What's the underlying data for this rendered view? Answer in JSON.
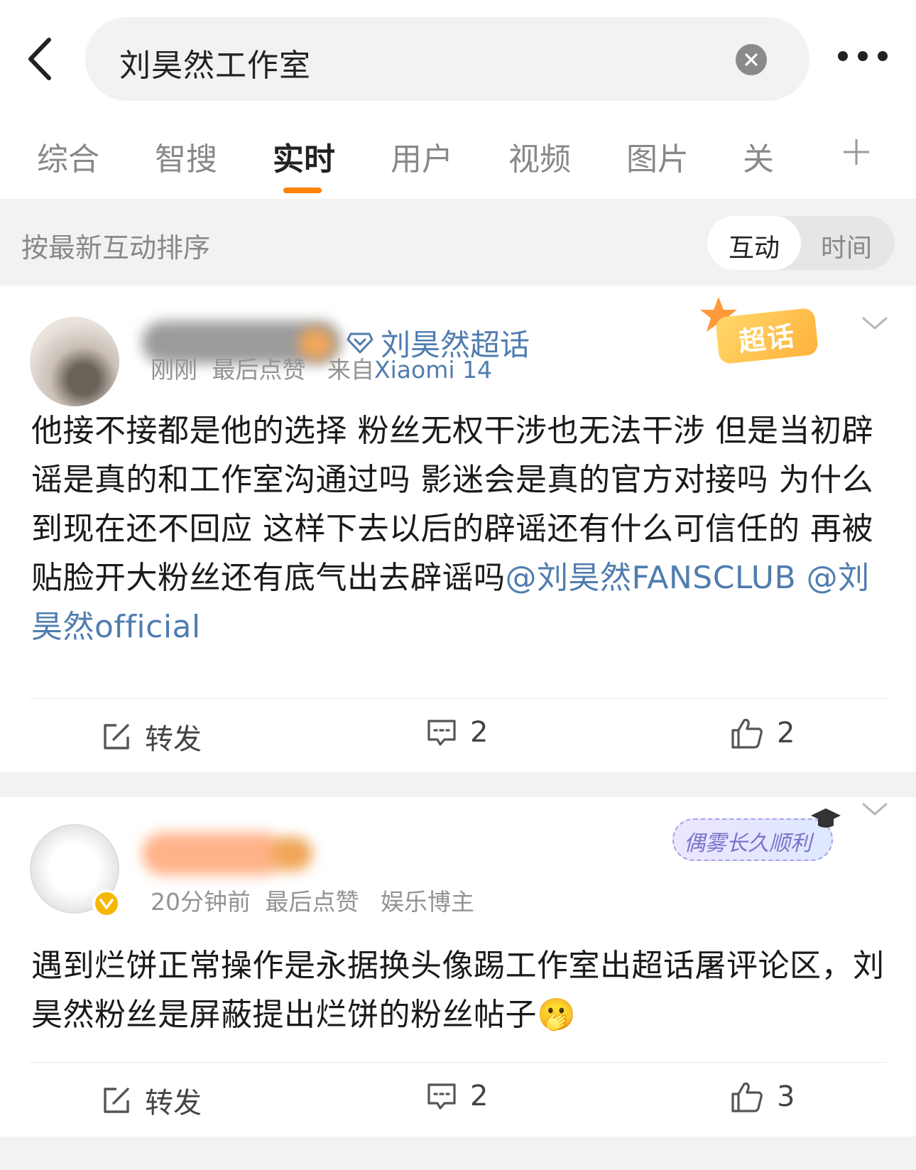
{
  "search": {
    "query": "刘昊然工作室"
  },
  "tabs": [
    {
      "label": "综合"
    },
    {
      "label": "智搜"
    },
    {
      "label": "实时"
    },
    {
      "label": "用户"
    },
    {
      "label": "视频"
    },
    {
      "label": "图片"
    },
    {
      "label": "关"
    }
  ],
  "active_tab_index": 2,
  "sort": {
    "label": "按最新互动排序",
    "options": [
      "互动",
      "时间"
    ],
    "selected": "互动"
  },
  "posts": [
    {
      "supertopic": "刘昊然超话",
      "badge_label": "超话",
      "time": "刚刚",
      "last_like": "最后点赞",
      "source_prefix": "来自",
      "device": "Xiaomi 14",
      "text": "他接不接都是他的选择 粉丝无权干涉也无法干涉 但是当初辟谣是真的和工作室沟通过吗 影迷会是真的官方对接吗 为什么到现在还不回应  这样下去以后的辟谣还有什么可信任的 再被贴脸开大粉丝还有底气出去辟谣吗",
      "mention1": "@刘昊然FANSCLUB",
      "mention2": "@刘昊然official",
      "repost_label": "转发",
      "comments": "2",
      "likes": "2"
    },
    {
      "fan_badge": "偶雾长久顺利",
      "time": "20分钟前",
      "last_like": "最后点赞",
      "role": "娱乐博主",
      "text": "遇到烂饼正常操作是永据换头像踢工作室出超话屠评论区，刘昊然粉丝是屏蔽提出烂饼的粉丝帖子",
      "emoji": "🫢",
      "repost_label": "转发",
      "comments": "2",
      "likes": "3"
    }
  ]
}
